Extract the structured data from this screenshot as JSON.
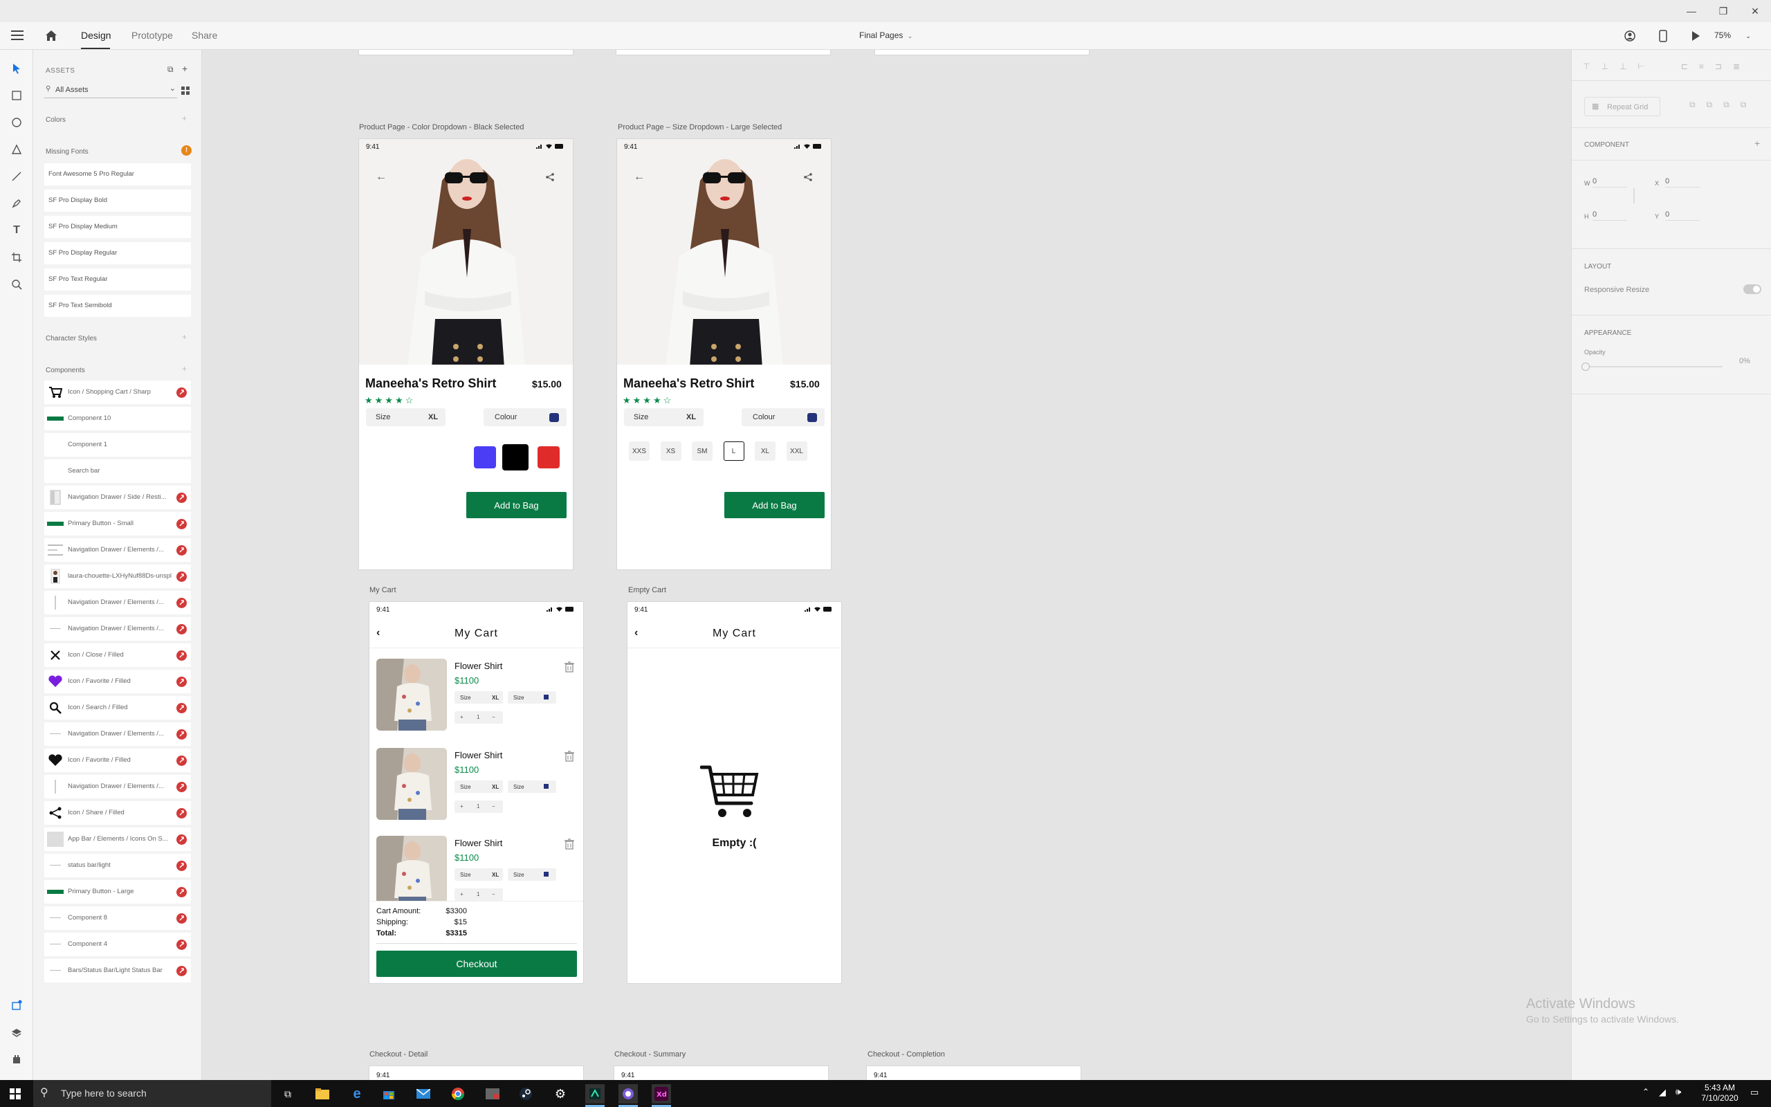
{
  "window": {
    "minimize": "—",
    "restore": "❐",
    "close": "✕"
  },
  "topnav": {
    "tabs": [
      "Design",
      "Prototype",
      "Share"
    ],
    "document_title": "Final Pages",
    "zoom": "75%"
  },
  "assets_panel": {
    "header": "ASSETS",
    "search_placeholder": "All Assets",
    "colors_label": "Colors",
    "missing_fonts_label": "Missing Fonts",
    "missing_fonts_count": "!",
    "fonts": [
      "Font Awesome 5 Pro Regular",
      "SF Pro Display Bold",
      "SF Pro Display Medium",
      "SF Pro Display Regular",
      "SF Pro Text Regular",
      "SF Pro Text Semibold"
    ],
    "character_styles_label": "Character Styles",
    "components_label": "Components",
    "components": [
      {
        "label": "Icon / Shopping Cart / Sharp",
        "icon": "cart-icon"
      },
      {
        "label": "Component 10",
        "icon": "green-bar"
      },
      {
        "label": "Component 1",
        "icon": "blank"
      },
      {
        "label": "Search bar",
        "icon": "blank"
      },
      {
        "label": "Navigation Drawer / Side / Resti...",
        "icon": "drawer"
      },
      {
        "label": "Primary Button - Small",
        "icon": "green-bar"
      },
      {
        "label": "Navigation Drawer / Elements /...",
        "icon": "lines"
      },
      {
        "label": "laura-chouette-LXHyNuf88Ds-unspl...",
        "icon": "photo"
      },
      {
        "label": "Navigation Drawer / Elements /...",
        "icon": "thin"
      },
      {
        "label": "Navigation Drawer / Elements /...",
        "icon": "dash"
      },
      {
        "label": "Icon / Close / Filled",
        "icon": "close-icon"
      },
      {
        "label": "Icon / Favorite / Filled",
        "icon": "heart-purple"
      },
      {
        "label": "Icon / Search / Filled",
        "icon": "search-icon"
      },
      {
        "label": "Navigation Drawer / Elements /...",
        "icon": "dash"
      },
      {
        "label": "Icon / Favorite / Filled",
        "icon": "heart-black"
      },
      {
        "label": "Navigation Drawer / Elements /...",
        "icon": "thin"
      },
      {
        "label": "Icon / Share / Filled",
        "icon": "share-icon"
      },
      {
        "label": "App Bar / Elements / Icons On S...",
        "icon": "gray-box"
      },
      {
        "label": "status bar/light",
        "icon": "dash"
      },
      {
        "label": "Primary Button - Large",
        "icon": "green-bar"
      },
      {
        "label": "Component 8",
        "icon": "dash"
      },
      {
        "label": "Component 4",
        "icon": "dash"
      },
      {
        "label": "Bars/Status Bar/Light Status Bar",
        "icon": "dash"
      }
    ]
  },
  "right_panel": {
    "repeat_grid": "Repeat Grid",
    "component_label": "COMPONENT",
    "w_label": "W",
    "w_value": "0",
    "x_label": "X",
    "x_value": "0",
    "h_label": "H",
    "h_value": "0",
    "y_label": "Y",
    "y_value": "0",
    "layout_label": "LAYOUT",
    "responsive_resize": "Responsive Resize",
    "appearance_label": "APPEARANCE",
    "opacity_label": "Opacity",
    "opacity_value": "0%"
  },
  "artboards": {
    "color_dropdown": {
      "title": "Product Page - Color Dropdown - Black Selected",
      "time": "9:41",
      "product_name": "Maneeha's Retro Shirt",
      "price": "$15.00",
      "rating": 4,
      "size_label": "Size",
      "size_value": "XL",
      "colour_label": "Colour",
      "swatches": [
        "#4a3df5",
        "#000000",
        "#e02b2b"
      ],
      "cta": "Add to Bag"
    },
    "size_dropdown": {
      "title": "Product Page – Size Dropdown - Large Selected",
      "time": "9:41",
      "product_name": "Maneeha's Retro Shirt",
      "price": "$15.00",
      "rating": 4,
      "size_label": "Size",
      "size_value": "XL",
      "colour_label": "Colour",
      "sizes": [
        "XXS",
        "XS",
        "SM",
        "L",
        "XL",
        "XXL"
      ],
      "selected_size": "L",
      "cta": "Add to Bag"
    },
    "my_cart": {
      "title": "My Cart",
      "time": "9:41",
      "header": "My Cart",
      "items": [
        {
          "name": "Flower Shirt",
          "price": "$1100",
          "size_label": "Size",
          "size": "XL",
          "color_label": "Size",
          "qty_minus": "+",
          "qty": "1",
          "qty_plus": "−"
        },
        {
          "name": "Flower Shirt",
          "price": "$1100",
          "size_label": "Size",
          "size": "XL",
          "color_label": "Size",
          "qty_minus": "+",
          "qty": "1",
          "qty_plus": "−"
        },
        {
          "name": "Flower Shirt",
          "price": "$1100",
          "size_label": "Size",
          "size": "XL",
          "color_label": "Size",
          "qty_minus": "+",
          "qty": "1",
          "qty_plus": "−"
        }
      ],
      "cart_amount_label": "Cart Amount:",
      "cart_amount": "$3300",
      "shipping_label": "Shipping:",
      "shipping": "$15",
      "total_label": "Total:",
      "total": "$3315",
      "cta": "Checkout"
    },
    "empty_cart": {
      "title": "Empty Cart",
      "time": "9:41",
      "header": "My Cart",
      "message": "Empty :("
    },
    "bottom_titles": [
      "Checkout - Detail",
      "Checkout - Summary",
      "Checkout - Completion"
    ],
    "bottom_time": "9:41"
  },
  "watermark": {
    "title": "Activate Windows",
    "subtitle": "Go to Settings to activate Windows."
  },
  "taskbar": {
    "search_placeholder": "Type here to search",
    "time": "5:43 AM",
    "date": "7/10/2020"
  }
}
